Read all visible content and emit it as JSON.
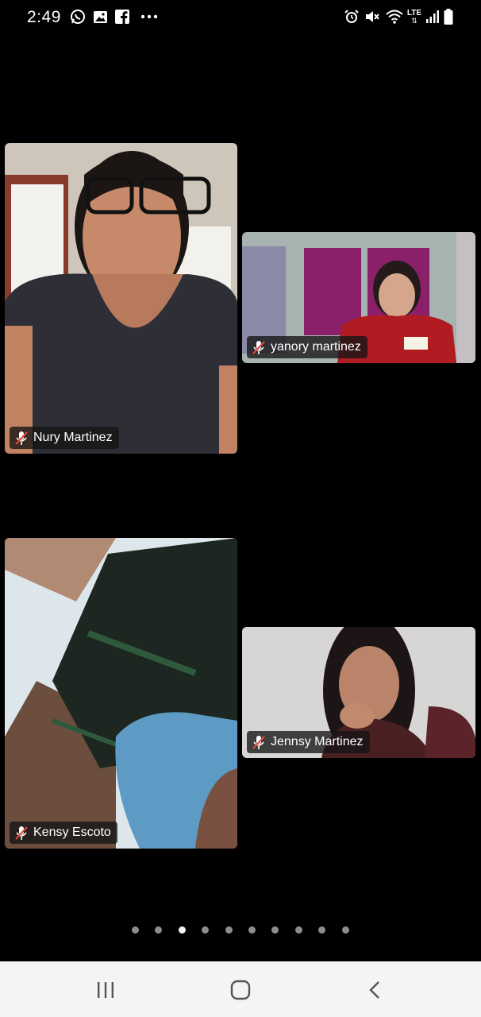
{
  "status_bar": {
    "time": "2:49",
    "network_label": "LTE",
    "left_icons": [
      "whatsapp-icon",
      "gallery-icon",
      "facebook-icon",
      "more-icon"
    ],
    "right_icons": [
      "alarm-icon",
      "mute-icon",
      "wifi-icon",
      "lte-icon",
      "signal-icon",
      "battery-icon"
    ]
  },
  "participants": [
    {
      "name": "Nury Martinez",
      "muted": true
    },
    {
      "name": "yanory martinez",
      "muted": true
    },
    {
      "name": "Kensy Escoto",
      "muted": true
    },
    {
      "name": "Jennsy Martinez",
      "muted": true
    }
  ],
  "pagination": {
    "total": 10,
    "active": 3
  },
  "nav_bar": {
    "buttons": [
      "recent-apps-button",
      "home-button",
      "back-button"
    ]
  },
  "colors": {
    "background": "#000000",
    "nav_background": "#f4f4f4",
    "muted_mic": "#e0463c"
  }
}
